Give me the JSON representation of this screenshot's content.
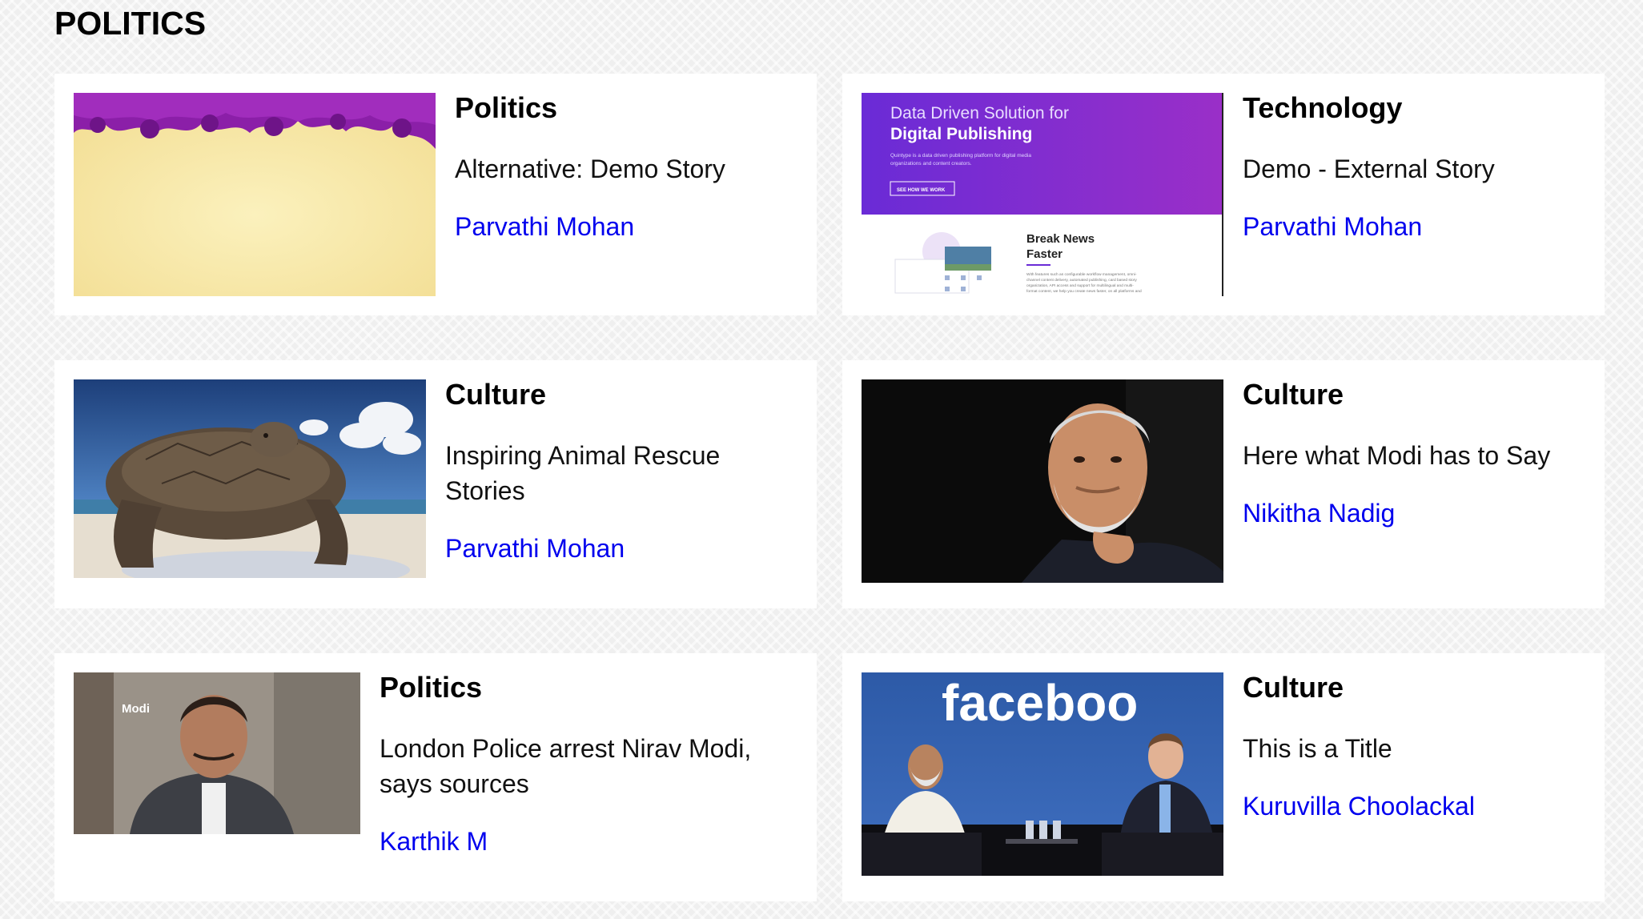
{
  "section": {
    "title": "POLITICS"
  },
  "stories": [
    {
      "section_label": "Politics",
      "headline": "Alternative: Demo Story",
      "author": "Parvathi Mohan",
      "image": "purple-feathers-on-yellow"
    },
    {
      "section_label": "Technology",
      "headline": "Demo - External Story",
      "author": "Parvathi Mohan",
      "image": "quintype-website-screenshot",
      "image_text": {
        "line1": "Data Driven Solution for",
        "line2": "Digital Publishing",
        "line3": "Quintype is a data driven publishing platform for digital media",
        "line4": "organizations and content creators.",
        "button": "SEE HOW WE WORK",
        "subhead1": "Break News",
        "subhead2": "Faster",
        "body1": "With features such as configurable workflow management, omni-",
        "body2": "channel content delivery, automated publishing, card based story",
        "body3": "organization, API access and support for multilingual and multi-",
        "body4": "format content, we help you create news faster, on all platforms and"
      }
    },
    {
      "section_label": "Culture",
      "headline": "Inspiring Animal Rescue Stories",
      "author": "Parvathi Mohan",
      "image": "giant-tortoise-on-beach"
    },
    {
      "section_label": "Culture",
      "headline": "Here what Modi has to Say",
      "author": "Nikitha Nadig",
      "image": "man-portrait-dark-background"
    },
    {
      "section_label": "Politics",
      "headline": "London Police arrest Nirav Modi, says sources",
      "author": "Karthik M",
      "image": "man-in-jacket-street",
      "image_text": {
        "caption": "Modi"
      }
    },
    {
      "section_label": "Culture",
      "headline": "This is a Title",
      "author": "Kuruvilla Choolackal",
      "image": "facebook-stage-talk",
      "image_text": {
        "banner": "faceboo"
      }
    }
  ],
  "colors": {
    "link": "#0000ee",
    "card_bg": "#ffffff",
    "page_bg": "#efefef"
  }
}
